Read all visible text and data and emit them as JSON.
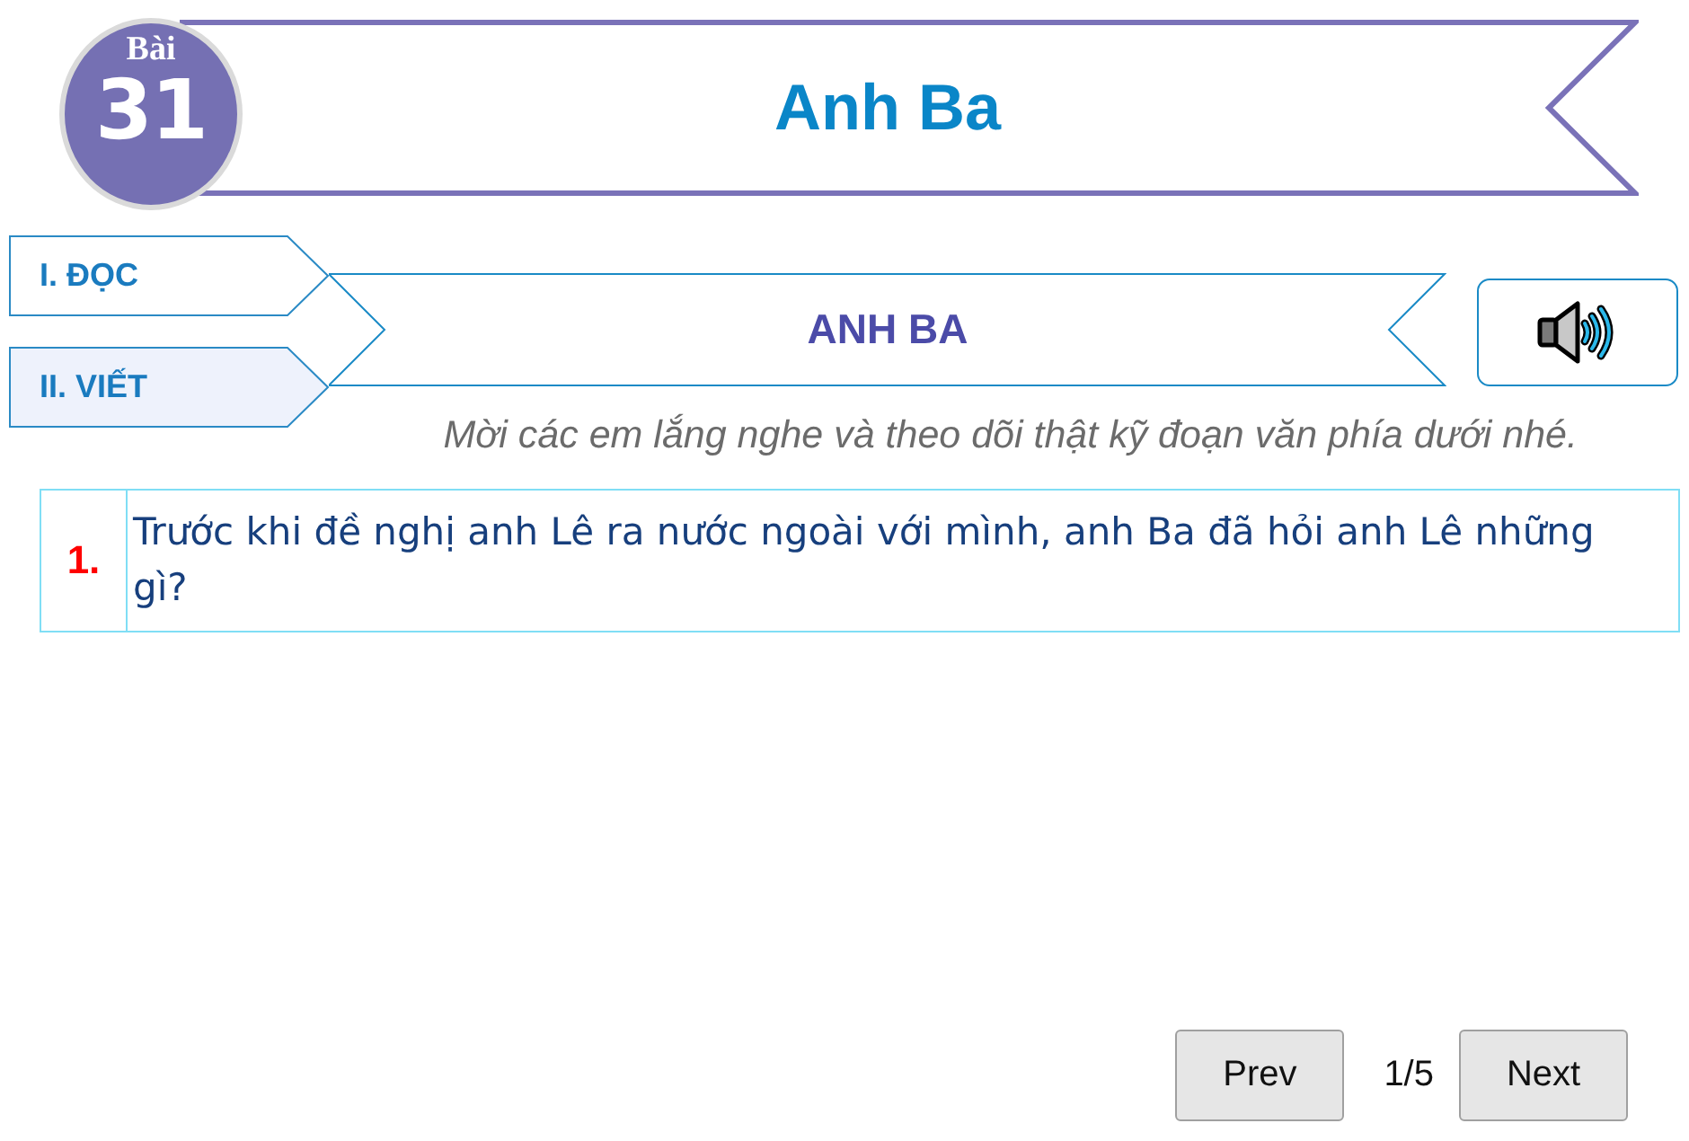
{
  "lesson": {
    "label": "Bài",
    "number": "31",
    "title": "Anh Ba"
  },
  "sections": [
    {
      "label": "I. ĐỌC",
      "selected": false
    },
    {
      "label": "II. VIẾT",
      "selected": true
    }
  ],
  "reading": {
    "title": "ANH BA",
    "instruction": "Mời các em lắng nghe và theo dõi thật kỹ đoạn văn phía dưới nhé."
  },
  "questions": [
    {
      "number": "1.",
      "text": "Trước khi đề nghị anh Lê ra nước ngoài với mình, anh Ba đã hỏi anh Lê những gì?"
    }
  ],
  "pager": {
    "prev": "Prev",
    "position": "1/5",
    "next": "Next"
  }
}
